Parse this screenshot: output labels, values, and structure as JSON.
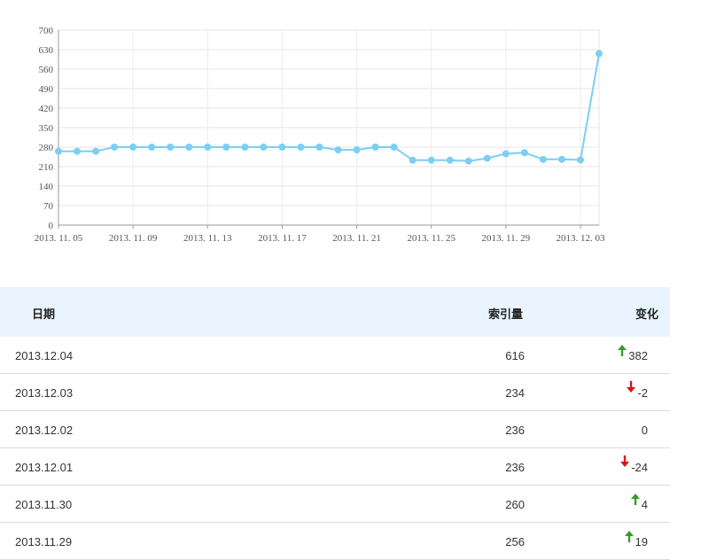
{
  "chart_data": {
    "type": "line",
    "x": [
      "2013.11.05",
      "2013.11.06",
      "2013.11.07",
      "2013.11.08",
      "2013.11.09",
      "2013.11.10",
      "2013.11.11",
      "2013.11.12",
      "2013.11.13",
      "2013.11.14",
      "2013.11.15",
      "2013.11.16",
      "2013.11.17",
      "2013.11.18",
      "2013.11.19",
      "2013.11.20",
      "2013.11.21",
      "2013.11.22",
      "2013.11.23",
      "2013.11.24",
      "2013.11.25",
      "2013.11.26",
      "2013.11.27",
      "2013.11.28",
      "2013.11.29",
      "2013.11.30",
      "2013.12.01",
      "2013.12.02",
      "2013.12.03",
      "2013.12.04"
    ],
    "series": [
      {
        "values": [
          265,
          265,
          265,
          280,
          280,
          280,
          280,
          280,
          280,
          280,
          280,
          280,
          280,
          280,
          280,
          270,
          270,
          280,
          280,
          233,
          233,
          233,
          230,
          240,
          256,
          260,
          236,
          236,
          234,
          616
        ],
        "color": "#7ccff1"
      }
    ],
    "x_tick_labels": [
      "2013. 11. 05",
      "2013. 11. 09",
      "2013. 11. 13",
      "2013. 11. 17",
      "2013. 11. 21",
      "2013. 11. 25",
      "2013. 11. 29",
      "2013. 12. 03"
    ],
    "y_ticks": [
      0,
      70,
      140,
      210,
      280,
      350,
      420,
      490,
      560,
      630,
      700
    ],
    "ylim": [
      0,
      700
    ],
    "grid": true
  },
  "table": {
    "headers": {
      "date": "日期",
      "index": "索引量",
      "change": "变化"
    },
    "rows": [
      {
        "date": "2013.12.04",
        "index": "616",
        "change": "382",
        "direction": "up"
      },
      {
        "date": "2013.12.03",
        "index": "234",
        "change": "-2",
        "direction": "down"
      },
      {
        "date": "2013.12.02",
        "index": "236",
        "change": "0",
        "direction": "none"
      },
      {
        "date": "2013.12.01",
        "index": "236",
        "change": "-24",
        "direction": "down"
      },
      {
        "date": "2013.11.30",
        "index": "260",
        "change": "4",
        "direction": "up"
      },
      {
        "date": "2013.11.29",
        "index": "256",
        "change": "19",
        "direction": "up"
      }
    ],
    "colors": {
      "up": "#3a9a2e",
      "down": "#d81414"
    }
  }
}
